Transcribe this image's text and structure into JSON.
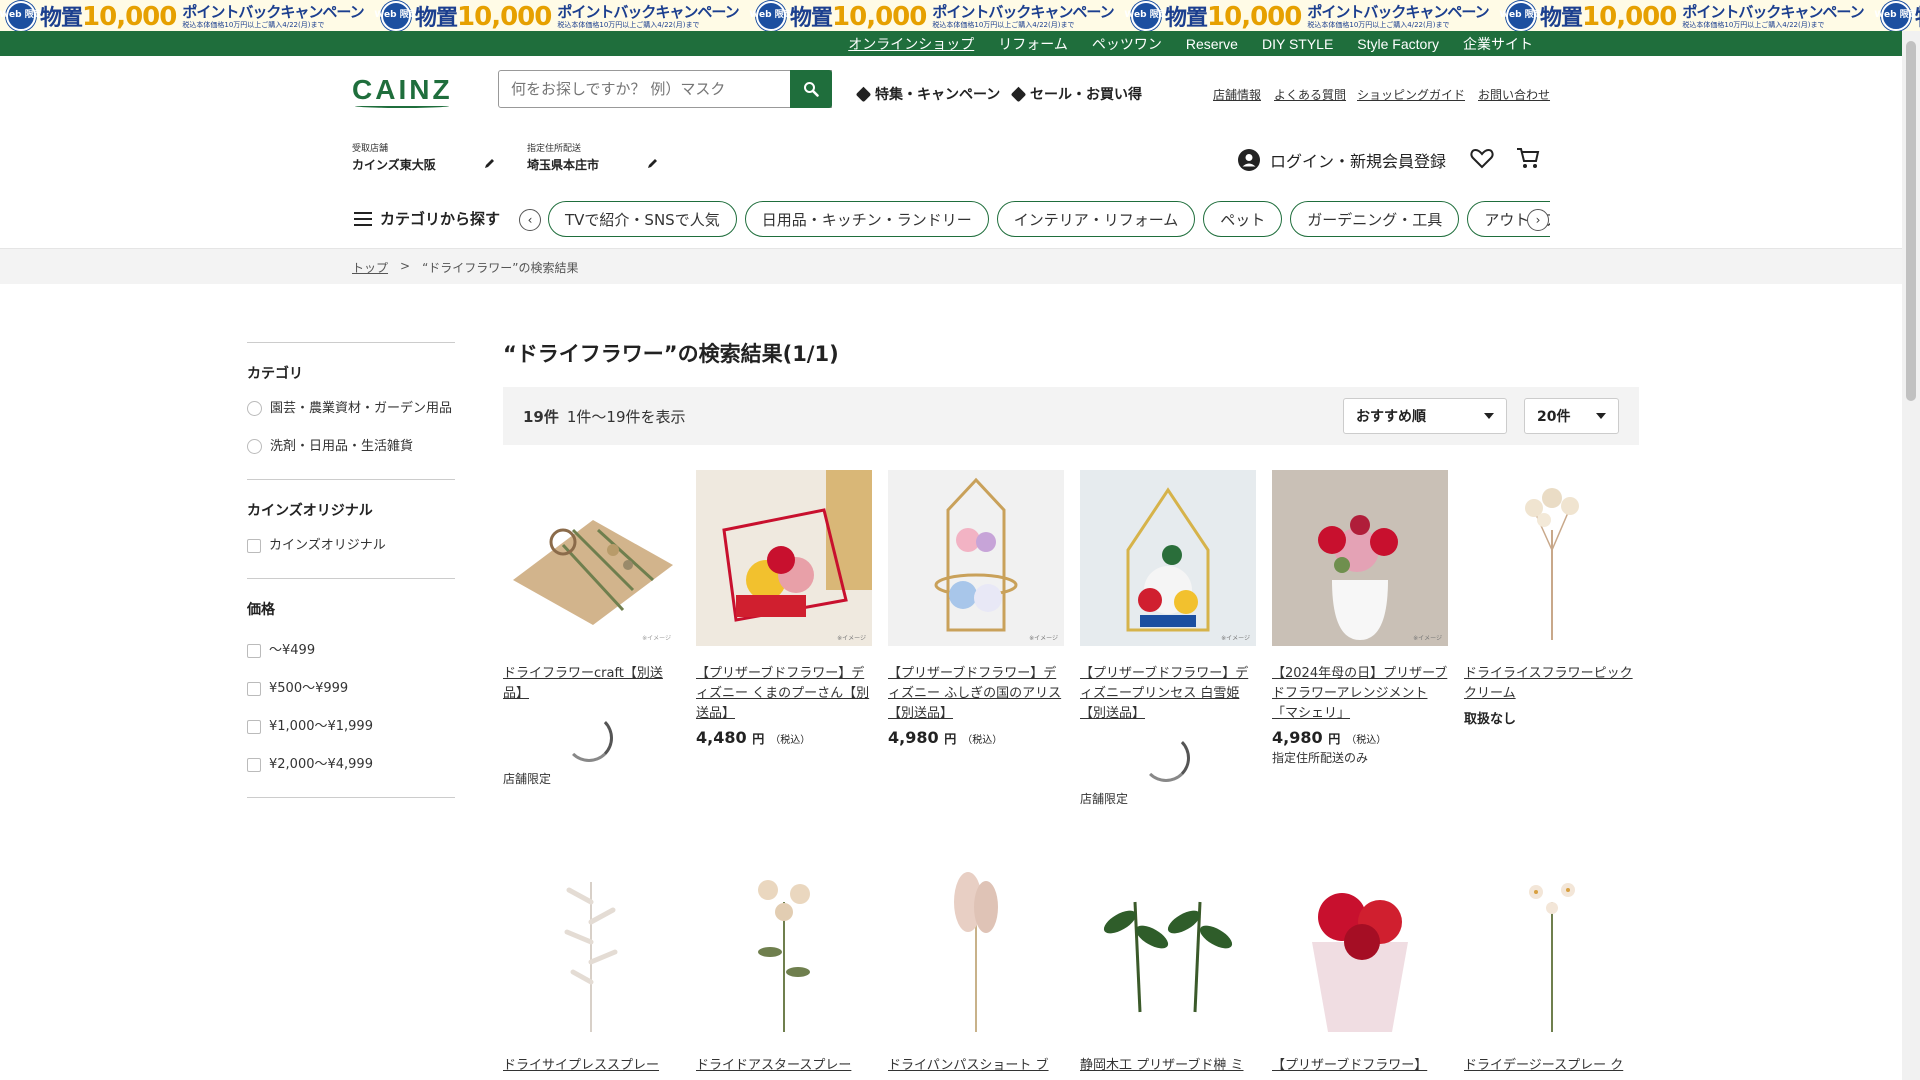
{
  "promo": {
    "badge": "Web 限定",
    "main_prefix": "物置",
    "main_number": "10,000",
    "sub": "ポイントバックキャンペーン",
    "note": "税込本体価格10万円以上ご購入4/22(月)まで"
  },
  "top_nav": [
    "オンラインショップ",
    "リフォーム",
    "ペッツワン",
    "Reserve",
    "DIY STYLE",
    "Style Factory",
    "企業サイト"
  ],
  "header": {
    "logo": "CAINZ",
    "search_placeholder": "何をお探しですか？ 例）マスク",
    "feature_link": "特集・キャンペーン",
    "sale_link": "セール・お買い得",
    "util_links": [
      "店舗情報",
      "よくある質問",
      "ショッピングガイド",
      "お問い合わせ"
    ],
    "store_label": "受取店舗",
    "store_value": "カインズ東大阪",
    "address_label": "指定住所配送",
    "address_value": "埼玉県本庄市",
    "login": "ログイン・新規会員登録"
  },
  "category_nav": {
    "menu_label": "カテゴリから探す",
    "chips": [
      "TVで紹介・SNSで人気",
      "日用品・キッチン・ランドリー",
      "インテリア・リフォーム",
      "ペット",
      "ガーデニング・工具",
      "アウトドア・カー用品"
    ]
  },
  "breadcrumb": {
    "home": "トップ",
    "separator": ">",
    "current": "“ドライフラワー”の検索結果"
  },
  "sidebar": {
    "category_title": "カテゴリ",
    "categories": [
      "園芸・農業資材・ガーデン用品",
      "洗剤・日用品・生活雑貨"
    ],
    "original_title": "カインズオリジナル",
    "original_option": "カインズオリジナル",
    "price_title": "価格",
    "prices": [
      "〜¥499",
      "¥500〜¥999",
      "¥1,000〜¥1,999",
      "¥2,000〜¥4,999"
    ]
  },
  "results": {
    "title": "“ドライフラワー”の検索結果(1/1)",
    "count": "19件",
    "range": "1件〜19件を表示",
    "sort": "おすすめ順",
    "per_page": "20件"
  },
  "products_row1": [
    {
      "name": "ドライフラワーcraft【別送品】",
      "limited": "店舗限定"
    },
    {
      "name": "【プリザーブドフラワー】ディズニー くまのプーさん【別送品】",
      "price": "4,480",
      "currency": "円",
      "tax": "（税込）"
    },
    {
      "name": "【プリザーブドフラワー】ディズニー ふしぎの国のアリス【別送品】",
      "price": "4,980",
      "currency": "円",
      "tax": "（税込）"
    },
    {
      "name": "【プリザーブドフラワー】ディズニープリンセス 白雪姫【別送品】",
      "limited": "店舗限定"
    },
    {
      "name": "【2024年母の日】プリザーブドフラワーアレンジメント「マシェリ」",
      "price": "4,980",
      "currency": "円",
      "tax": "（税込）",
      "note": "指定住所配送のみ"
    },
    {
      "name": "ドライライスフラワーピック クリーム",
      "unavailable": "取扱なし"
    }
  ],
  "products_row2": [
    {
      "name": "ドライサイプレススプレー"
    },
    {
      "name": "ドライドアスタースプレー"
    },
    {
      "name": "ドライパンパスショート ブ"
    },
    {
      "name": "静岡木工 プリザーブド榊 ミ"
    },
    {
      "name": "【プリザーブドフラワー】"
    },
    {
      "name": "ドライデージースプレー ク"
    }
  ],
  "image_note": "※イメージ",
  "colors": {
    "brand_green": "#1f6e3c",
    "banner_blue": "#1c3f8f",
    "banner_gold": "#e6a000"
  }
}
